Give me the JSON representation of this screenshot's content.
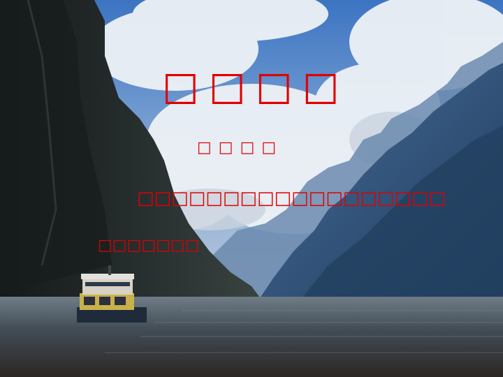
{
  "slide": {
    "title": "□□□□",
    "subtitle": "□□□□",
    "line1": "□□□□□□□□□□□□□□□□□□",
    "line2": "□□□□□□□"
  },
  "colors": {
    "text": "#e00000",
    "sky": "#4a7fc4",
    "cloud": "#e8eef4",
    "cliff": "#1e2a2c",
    "mountain": "#3d5f86",
    "water": "#3a4550"
  },
  "icons": {
    "boat": "boat-illustration"
  }
}
